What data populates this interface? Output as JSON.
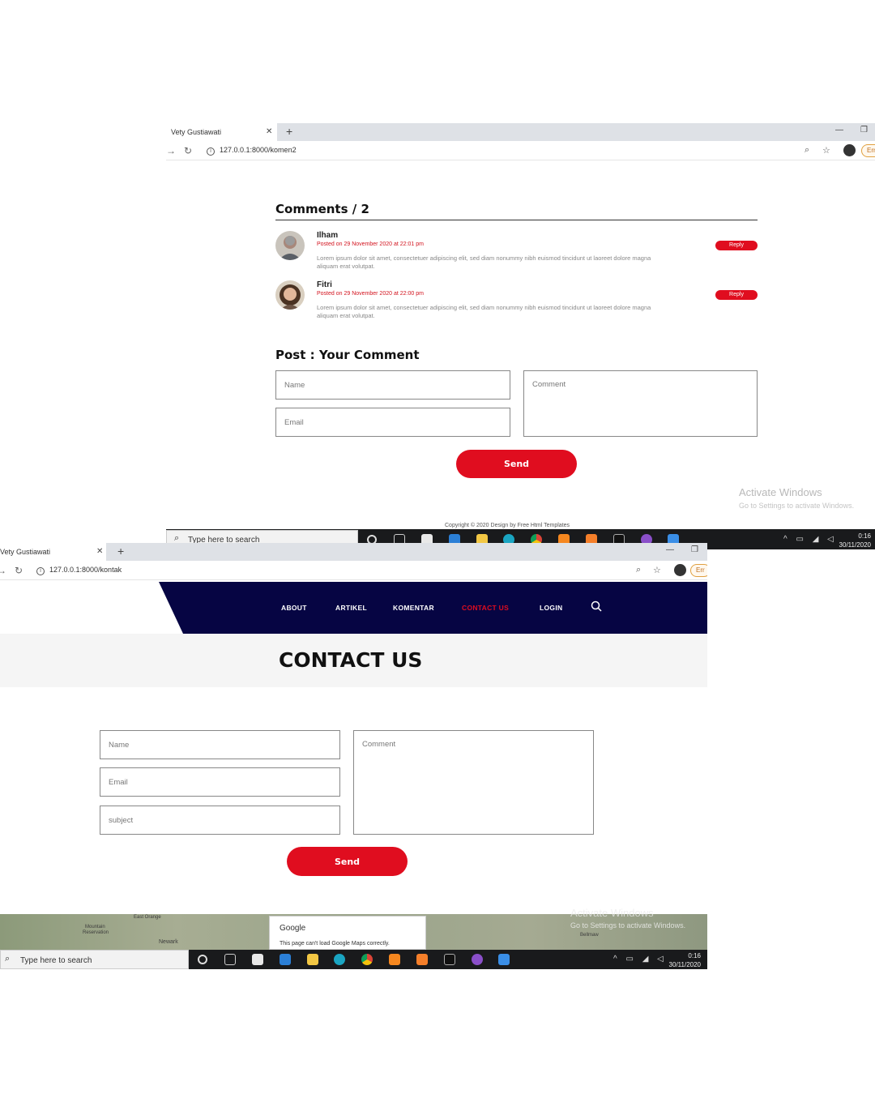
{
  "screen1": {
    "tab_title": "Vety Gustiawati",
    "url": "127.0.0.1:8000/komen2",
    "ext_badge": "Err",
    "comments_heading": "Comments / 2",
    "comments": [
      {
        "name": "Ilham",
        "date": "Posted on 29 November 2020 at 22:01 pm",
        "body": "Lorem ipsum dolor sit amet, consectetuer adipiscing elit, sed diam nonummy nibh euismod tincidunt ut laoreet dolore magna aliquam erat volutpat.",
        "reply": "Reply"
      },
      {
        "name": "Fitri",
        "date": "Posted on 29 November 2020 at 22:00 pm",
        "body": "Lorem ipsum dolor sit amet, consectetuer adipiscing elit, sed diam nonummy nibh euismod tincidunt ut laoreet dolore magna aliquam erat volutpat.",
        "reply": "Reply"
      }
    ],
    "post_heading": "Post : Your Comment",
    "form": {
      "name": "Name",
      "email": "Email",
      "comment": "Comment",
      "send": "Send"
    },
    "activate_title": "Activate Windows",
    "activate_sub": "Go to Settings to activate Windows.",
    "copyright": "Copyright © 2020 Design by Free Html Templates",
    "taskbar_search": "Type here to search",
    "clock_time": "0:16",
    "clock_date": "30/11/2020"
  },
  "screen2": {
    "tab_title": "Vety Gustiawati",
    "url": "127.0.0.1:8000/kontak",
    "ext_badge": "Err",
    "nav": [
      "ABOUT",
      "ARTIKEL",
      "KOMENTAR",
      "CONTACT US",
      "LOGIN"
    ],
    "active_nav": "CONTACT US",
    "hero_title": "CONTACT US",
    "form": {
      "name": "Name",
      "email": "Email",
      "subject": "subject",
      "comment": "Comment",
      "send": "Send"
    },
    "map_dialog_title": "Google",
    "map_dialog_text": "This page can't load Google Maps correctly.",
    "map_labels": [
      "Mountain",
      "Reservation",
      "East Orange",
      "Newark",
      "Bellmaw"
    ],
    "activate_title": "Activate Windows",
    "activate_sub": "Go to Settings to activate Windows.",
    "taskbar_search": "Type here to search",
    "clock_time": "0:16",
    "clock_date": "30/11/2020"
  },
  "colors": {
    "accent_red": "#e00d1f",
    "nav_navy": "#060543",
    "taskbar": "#191a1c"
  }
}
